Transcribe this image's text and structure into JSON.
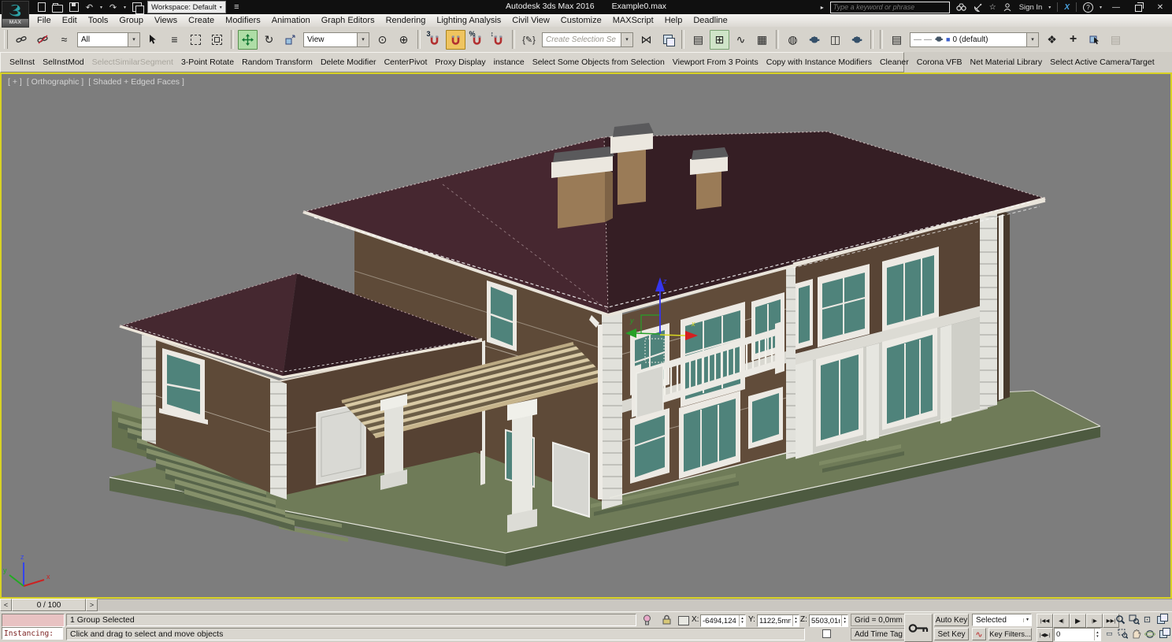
{
  "window": {
    "logo": "MAX",
    "app_title": "Autodesk 3ds Max 2016",
    "doc_title": "Example0.max",
    "workspace": "Workspace: Default",
    "search_placeholder": "Type a keyword or phrase",
    "sign_in": "Sign In"
  },
  "menu": {
    "items": [
      "File",
      "Edit",
      "Tools",
      "Group",
      "Views",
      "Create",
      "Modifiers",
      "Animation",
      "Graph Editors",
      "Rendering",
      "Lighting Analysis",
      "Civil View",
      "Customize",
      "MAXScript",
      "Help",
      "Deadline"
    ]
  },
  "toolbar": {
    "selection_filter": "All",
    "coord_system": "View",
    "named_sets_placeholder": "Create Selection Se",
    "snap_label": "3",
    "layer": "0 (default)"
  },
  "script_toolbar": {
    "buttons": [
      "SelInst",
      "SelInstMod",
      "SelectSimilarSegment",
      "3-Point Rotate",
      "Random Transform",
      "Delete Modifier",
      "CenterPivot",
      "Proxy Display",
      "instance",
      "Select Some Objects from Selection",
      "Viewport From 3 Points",
      "Copy with Instance Modifiers",
      "Cleaner",
      "Corona VFB",
      "Net Material Library",
      "Select Active Camera/Target"
    ]
  },
  "viewport": {
    "label_maximize": "[ + ]",
    "label_pov": "[ Orthographic ]",
    "label_shading": "[ Shaded + Edged Faces ]",
    "gizmo": {
      "x": "x",
      "y": "y",
      "z": "z"
    },
    "world_axis": {
      "x": "x",
      "y": "y",
      "z": "z"
    }
  },
  "timeline": {
    "value": "0 / 100"
  },
  "status": {
    "listener_text": "Instancing:",
    "selection_status": "1 Group Selected",
    "prompt": "Click and drag to select and move objects",
    "x_label": "X:",
    "x_value": "-6494,124",
    "y_label": "Y:",
    "y_value": "1122,5mm",
    "z_label": "Z:",
    "z_value": "5503,01mr",
    "grid_label": "Grid = 0,0mm",
    "add_time_tag": "Add Time Tag",
    "auto_key": "Auto Key",
    "set_key": "Set Key",
    "selection_set": "Selected",
    "key_filters": "Key Filters...",
    "frame_value": "0"
  },
  "icons": {
    "dropdown": "▾",
    "up": "▴",
    "down": "▾",
    "undo": "↶",
    "redo": "↷",
    "menu_overflow": "≡",
    "search_go": "▸",
    "star": "☆",
    "help": "?",
    "exchange": "X",
    "minimize": "—",
    "close": "✕",
    "bind_spacewarp": "≈",
    "select_by_name": "≡",
    "rotate": "↻",
    "use_center": "⊙",
    "manipulate": "⊕",
    "spinner_snap": "↕",
    "percent": "%",
    "named_sets": "{✎}",
    "mirror": "⋈",
    "curve_editor": "∿",
    "schematic": "▦",
    "material": "◍",
    "rendered_frame": "◫",
    "layers": "▤",
    "new_layer": "❖",
    "add_to_layer": "+",
    "layer_dash": "—",
    "layer_swatch": "■",
    "explorer": "⊞",
    "zoom_extents": "⊡",
    "pan2d": "▭",
    "go_start": "|◀◀",
    "prev_frame": "◀|",
    "play": "▶",
    "next_frame": "|▶",
    "go_end": "▶▶|",
    "key_mode": "|◀▶|",
    "slider_prev": "<",
    "slider_next": ">"
  },
  "colors": {
    "active_viewport_border": "#d8d224",
    "viewport_bg": "#7d7d7d",
    "roof": "#3a2127",
    "wall_brown": "#5f4b39",
    "trim_white": "#e3e3df",
    "window_teal": "#4f837b",
    "ground_green": "#6f7b58",
    "move_active": "#aedda6",
    "snap_active": "#efc45f"
  }
}
